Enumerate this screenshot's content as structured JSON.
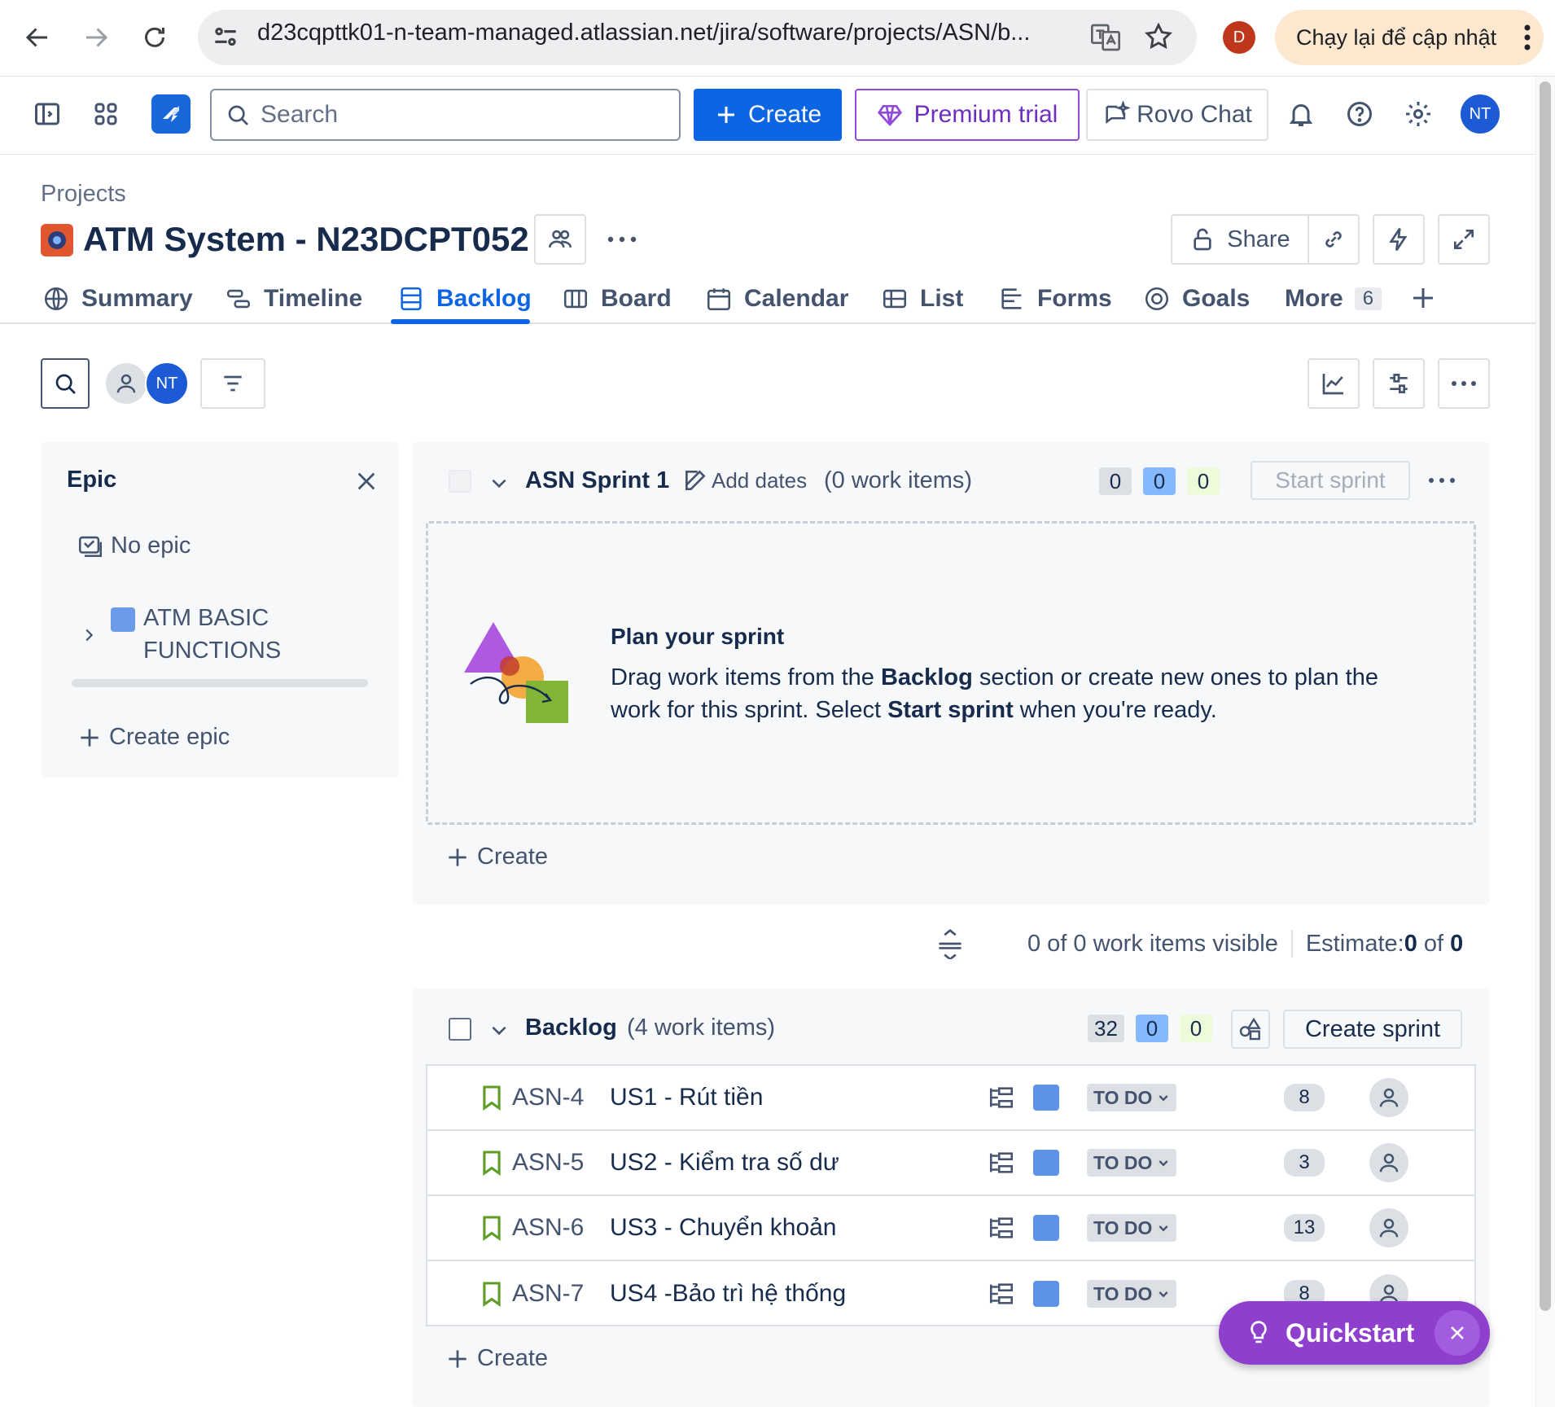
{
  "browser": {
    "url": "d23cqpttk01-n-team-managed.atlassian.net/jira/software/projects/ASN/b...",
    "profile_initial": "D",
    "reload_label": "Chạy lại để cập nhật"
  },
  "topnav": {
    "search_placeholder": "Search",
    "create_label": "Create",
    "premium_label": "Premium trial",
    "rovo_label": "Rovo Chat",
    "user_initials": "NT"
  },
  "project": {
    "breadcrumb": "Projects",
    "title": "ATM System - N23DCPT052",
    "share_label": "Share"
  },
  "tabs": [
    {
      "label": "Summary"
    },
    {
      "label": "Timeline"
    },
    {
      "label": "Backlog"
    },
    {
      "label": "Board"
    },
    {
      "label": "Calendar"
    },
    {
      "label": "List"
    },
    {
      "label": "Forms"
    },
    {
      "label": "Goals"
    },
    {
      "label": "More",
      "badge": "6"
    }
  ],
  "filters": {
    "user_initials": "NT"
  },
  "epic_panel": {
    "title": "Epic",
    "no_epic": "No epic",
    "epic_name_line1": "ATM BASIC",
    "epic_name_line2": "FUNCTIONS",
    "create_epic": "Create epic"
  },
  "sprint": {
    "name": "ASN Sprint 1",
    "add_dates": "Add dates",
    "count_text": "(0 work items)",
    "counts": [
      "0",
      "0",
      "0"
    ],
    "start_label": "Start sprint",
    "plan_title": "Plan your sprint",
    "plan_text_1": "Drag work items from the ",
    "plan_bold_1": "Backlog",
    "plan_text_2": " section or create new ones to plan the",
    "plan_text_3": "work for this sprint. Select ",
    "plan_bold_2": "Start sprint",
    "plan_text_4": " when you're ready.",
    "create_label": "Create"
  },
  "summary_bar": {
    "visible_text": "0 of 0 work items visible",
    "estimate_label": "Estimate: ",
    "estimate_a": "0",
    "estimate_of": " of ",
    "estimate_b": "0"
  },
  "backlog": {
    "name": "Backlog",
    "count_text": "(4 work items)",
    "counts": [
      "32",
      "0",
      "0"
    ],
    "create_sprint": "Create sprint",
    "create_label": "Create",
    "items": [
      {
        "key": "ASN-4",
        "summary": "US1 - Rút tiền",
        "status": "TO DO",
        "estimate": "8"
      },
      {
        "key": "ASN-5",
        "summary": "US2 - Kiểm tra số dư",
        "status": "TO DO",
        "estimate": "3"
      },
      {
        "key": "ASN-6",
        "summary": "US3 - Chuyển khoản",
        "status": "TO DO",
        "estimate": "13"
      },
      {
        "key": "ASN-7",
        "summary": "US4 -Bảo trì hệ thống",
        "status": "TO DO",
        "estimate": "8"
      }
    ]
  },
  "quickstart": {
    "label": "Quickstart"
  },
  "colors": {
    "accent": "#0c66e4",
    "premium": "#6e2ebf",
    "quickstart": "#8f3fce",
    "epic": "#5e92e6"
  }
}
